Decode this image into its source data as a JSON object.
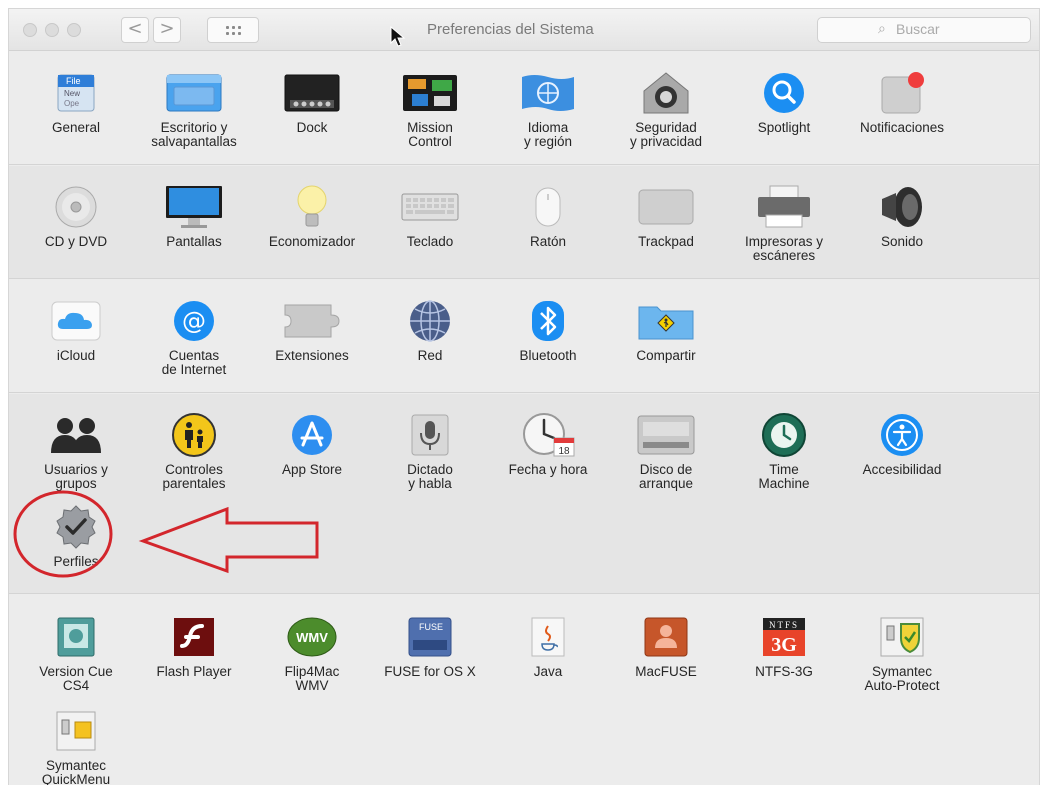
{
  "window": {
    "title": "Preferencias del Sistema",
    "search_placeholder": "Buscar",
    "back_glyph": "<",
    "forward_glyph": ">"
  },
  "sections": [
    {
      "panes": [
        {
          "label": "General",
          "icon": "general-icon"
        },
        {
          "label": "Escritorio y\nsalvapantallas",
          "icon": "desktop-icon"
        },
        {
          "label": "Dock",
          "icon": "dock-icon"
        },
        {
          "label": "Mission\nControl",
          "icon": "mission-control-icon"
        },
        {
          "label": "Idioma\ny región",
          "icon": "language-icon"
        },
        {
          "label": "Seguridad\ny privacidad",
          "icon": "security-icon"
        },
        {
          "label": "Spotlight",
          "icon": "spotlight-icon"
        },
        {
          "label": "Notificaciones",
          "icon": "notifications-icon"
        }
      ]
    },
    {
      "panes": [
        {
          "label": "CD y DVD",
          "icon": "cd-dvd-icon"
        },
        {
          "label": "Pantallas",
          "icon": "displays-icon"
        },
        {
          "label": "Economizador",
          "icon": "energy-saver-icon"
        },
        {
          "label": "Teclado",
          "icon": "keyboard-icon"
        },
        {
          "label": "Ratón",
          "icon": "mouse-icon"
        },
        {
          "label": "Trackpad",
          "icon": "trackpad-icon"
        },
        {
          "label": "Impresoras y\nescáneres",
          "icon": "printer-icon"
        },
        {
          "label": "Sonido",
          "icon": "sound-icon"
        }
      ]
    },
    {
      "panes": [
        {
          "label": "iCloud",
          "icon": "icloud-icon"
        },
        {
          "label": "Cuentas\nde Internet",
          "icon": "internet-accounts-icon"
        },
        {
          "label": "Extensiones",
          "icon": "extensions-icon"
        },
        {
          "label": "Red",
          "icon": "network-icon"
        },
        {
          "label": "Bluetooth",
          "icon": "bluetooth-icon"
        },
        {
          "label": "Compartir",
          "icon": "sharing-icon"
        }
      ]
    },
    {
      "panes": [
        {
          "label": "Usuarios y\ngrupos",
          "icon": "users-icon"
        },
        {
          "label": "Controles\nparentales",
          "icon": "parental-controls-icon"
        },
        {
          "label": "App Store",
          "icon": "app-store-icon"
        },
        {
          "label": "Dictado\ny habla",
          "icon": "dictation-icon"
        },
        {
          "label": "Fecha y hora",
          "icon": "date-time-icon"
        },
        {
          "label": "Disco de\narranque",
          "icon": "startup-disk-icon"
        },
        {
          "label": "Time\nMachine",
          "icon": "time-machine-icon"
        },
        {
          "label": "Accesibilidad",
          "icon": "accessibility-icon"
        },
        {
          "label": "Perfiles",
          "icon": "profiles-icon"
        }
      ]
    },
    {
      "panes": [
        {
          "label": "Version Cue\nCS4",
          "icon": "version-cue-icon"
        },
        {
          "label": "Flash Player",
          "icon": "flash-player-icon"
        },
        {
          "label": "Flip4Mac\nWMV",
          "icon": "flip4mac-icon"
        },
        {
          "label": "FUSE for OS X",
          "icon": "fuse-icon"
        },
        {
          "label": "Java",
          "icon": "java-icon"
        },
        {
          "label": "MacFUSE",
          "icon": "macfuse-icon"
        },
        {
          "label": "NTFS-3G",
          "icon": "ntfs-3g-icon"
        },
        {
          "label": "Symantec\nAuto-Protect",
          "icon": "symantec-autoprotect-icon"
        },
        {
          "label": "Symantec\nQuickMenu",
          "icon": "symantec-quickmenu-icon"
        }
      ]
    }
  ],
  "icon_text": {
    "general_file": "File",
    "general_new": "New",
    "general_open": "Ope",
    "wmv": "WMV",
    "fuse": "FUSE",
    "ntfs": "NTFS",
    "ntfs_3g": "3G",
    "calendar_day": "18"
  },
  "colors": {
    "annotation_red": "#d3262c",
    "accent_blue": "#1b8ef2"
  }
}
